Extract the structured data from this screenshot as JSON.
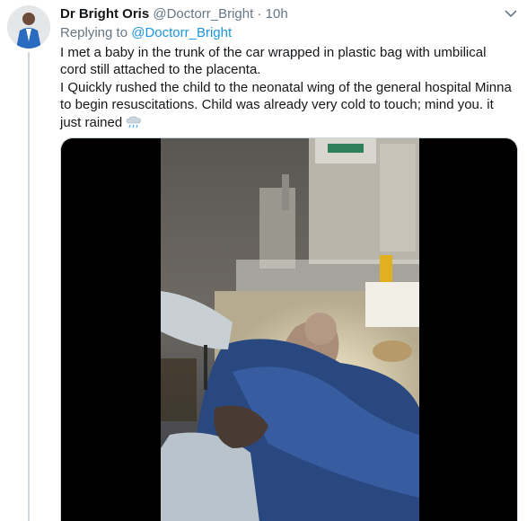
{
  "tweet": {
    "author_name": "Dr Bright Oris",
    "author_handle": "@Doctorr_Bright",
    "separator": "·",
    "timestamp": "10h",
    "replying_prefix": "Replying to",
    "replying_to": "@Doctorr_Bright",
    "text_line1": "I met a baby in the trunk of the car wrapped in plastic bag with umbilical cord still attached to the placenta.",
    "text_line2": "I Quickly rushed the child to the neonatal wing of the general hospital Minna to begin resuscitations. Child was already very cold to touch; mind you. it just rained",
    "emoji": "cloud-with-rain-icon"
  },
  "media": {
    "type": "video",
    "icons": [
      "caret-down-icon"
    ]
  },
  "colors": {
    "link": "#1b95e0",
    "secondary_text": "#657786",
    "divider": "#ccd6dd"
  }
}
